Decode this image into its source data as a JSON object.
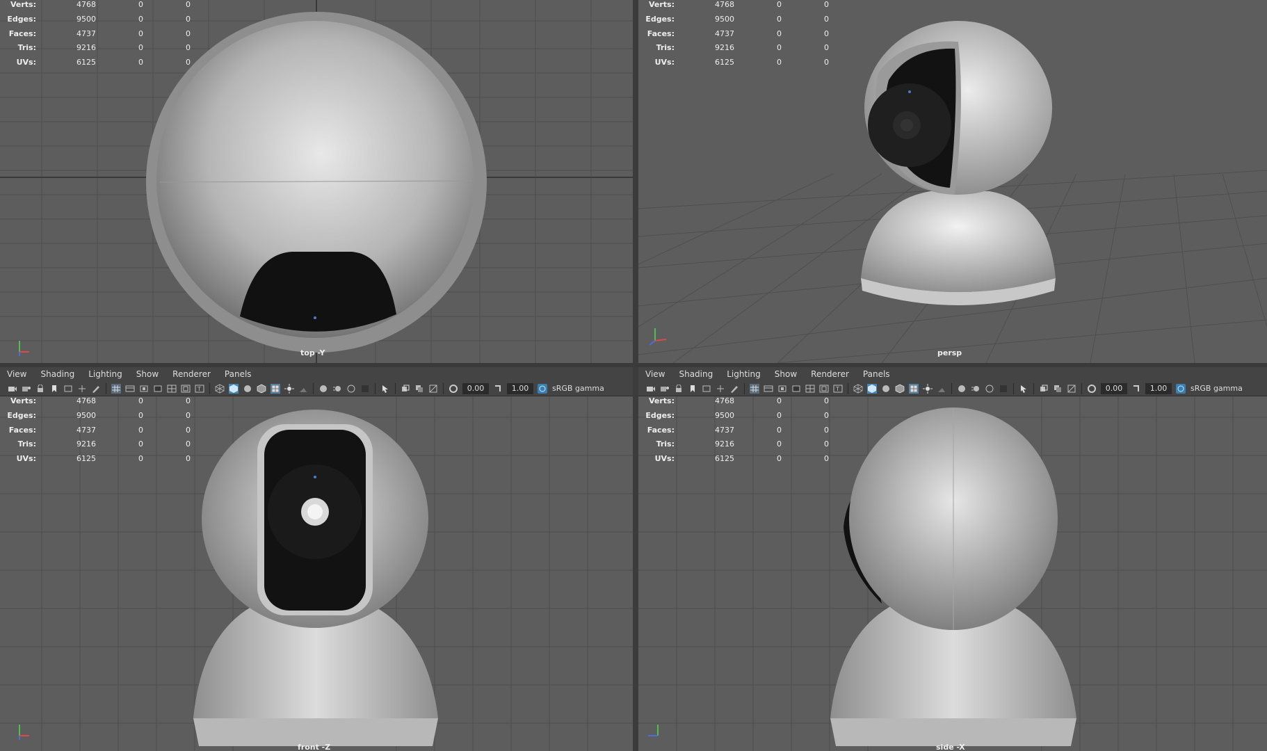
{
  "menu": [
    "View",
    "Shading",
    "Lighting",
    "Show",
    "Renderer",
    "Panels"
  ],
  "stats": {
    "labels": [
      "Verts:",
      "Edges:",
      "Faces:",
      "Tris:",
      "UVs:"
    ],
    "values": [
      [
        "4768",
        "0",
        "0"
      ],
      [
        "9500",
        "0",
        "0"
      ],
      [
        "4737",
        "0",
        "0"
      ],
      [
        "9216",
        "0",
        "0"
      ],
      [
        "6125",
        "0",
        "0"
      ]
    ]
  },
  "toolbar": {
    "exposure": "0.00",
    "gamma": "1.00",
    "color_space": "sRGB gamma"
  },
  "panes": {
    "top": {
      "camera": "top -Y"
    },
    "persp": {
      "camera": "persp"
    },
    "front": {
      "camera": "front -Z"
    },
    "side": {
      "camera": "side -X"
    }
  },
  "colors": {
    "viewport_bg": "#5d5d5d",
    "grid": "#4a4a4a",
    "ui_bar": "#444444",
    "accent": "#4fb3d9"
  },
  "icons": [
    "camera-icon",
    "select-camera-icon",
    "lock-camera-icon",
    "bookmark-icon",
    "image-plane-icon",
    "2d-pan-icon",
    "grease-pencil-icon",
    "grid-icon",
    "film-gate-icon",
    "resolution-gate-icon",
    "gate-mask-icon",
    "field-chart-icon",
    "safe-action-icon",
    "safe-title-icon",
    "wireframe-icon",
    "smooth-shade-icon",
    "default-material-icon",
    "shaded-wireframe-icon",
    "textured-icon",
    "use-all-lights-icon",
    "shadows-icon",
    "ssao-icon",
    "motion-blur-icon",
    "anti-alias-icon",
    "depth-of-field-icon",
    "isolate-select-icon",
    "xray-icon",
    "xray-joints-icon",
    "xray-active-icon",
    "backface-cull-icon",
    "exposure-icon",
    "gamma-icon",
    "color-management-icon"
  ]
}
